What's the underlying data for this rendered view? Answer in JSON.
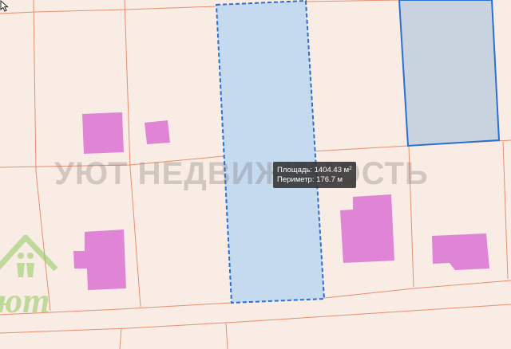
{
  "map": {
    "background_color": "#f9ece4",
    "parcel_line_color": "#e58f6f",
    "selected_parcel": {
      "fill": "#c5daee",
      "outline": "#2b6fcf",
      "outline_style": "dashed"
    },
    "neighbor_parcel": {
      "fill": "#c9d3df",
      "outline": "#2b6fcf"
    },
    "building_color": "#e085d6"
  },
  "tooltip": {
    "area_label": "Площадь:",
    "area_value": "1404.43",
    "area_unit": "м",
    "area_unit_power": "2",
    "perimeter_label": "Периметр:",
    "perimeter_value": "176.7",
    "perimeter_unit": "м"
  },
  "watermark": {
    "text": "УЮТ НЕДВИЖИМОСТЬ",
    "logo_text": "ют",
    "logo_color": "#8fcb5c"
  },
  "icons": {
    "cursor": "arrow-cursor-icon",
    "logo": "house-family-logo-icon"
  }
}
